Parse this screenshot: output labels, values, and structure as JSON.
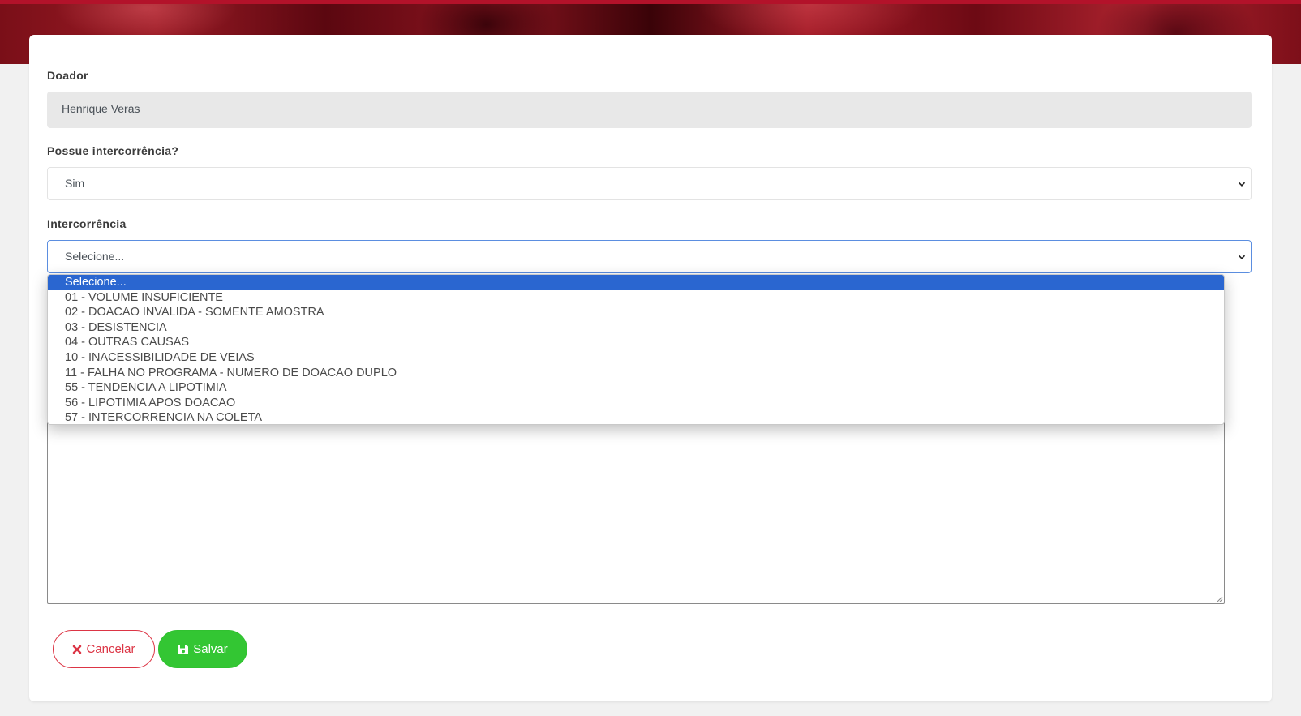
{
  "form": {
    "donor_label": "Doador",
    "donor_value": "Henrique Veras",
    "has_incident_label": "Possue intercorrência?",
    "has_incident_value": "Sim",
    "incident_label": "Intercorrência",
    "incident_value": "Selecione...",
    "incident_options": [
      "Selecione...",
      "01 - VOLUME INSUFICIENTE",
      "02 - DOACAO INVALIDA - SOMENTE AMOSTRA",
      "03 - DESISTENCIA",
      "04 - OUTRAS CAUSAS",
      "10 - INACESSIBILIDADE DE VEIAS",
      "11 - FALHA NO PROGRAMA - NUMERO DE DOACAO DUPLO",
      "55 - TENDENCIA A LIPOTIMIA",
      "56 - LIPOTIMIA APOS DOACAO",
      "57 - INTERCORRENCIA NA COLETA"
    ],
    "notes_value": ""
  },
  "actions": {
    "cancel_label": "Cancelar",
    "save_label": "Salvar"
  },
  "icons": {
    "cancel": "close-icon",
    "save": "floppy-disk-icon",
    "select_arrow": "chevron-down-icon"
  },
  "colors": {
    "cancel": "#dc3545",
    "save": "#33c633",
    "selected_option": "#2a66d0"
  }
}
